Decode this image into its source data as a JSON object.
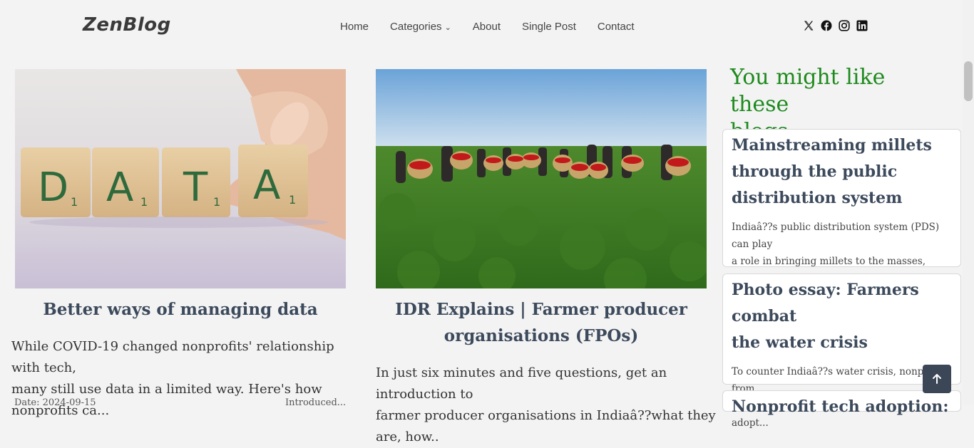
{
  "brand": {
    "logo": "ZenBlog"
  },
  "nav": {
    "items": [
      {
        "label": "Home"
      },
      {
        "label": "Categories"
      },
      {
        "label": "About"
      },
      {
        "label": "Single Post"
      },
      {
        "label": "Contact"
      }
    ]
  },
  "social": [
    "x-icon",
    "facebook-icon",
    "instagram-icon",
    "linkedin-icon"
  ],
  "posts": [
    {
      "title": "Better ways of managing data",
      "excerpt_line1": "While COVID-19 changed nonprofits' relationship with tech,",
      "excerpt_line2": "many still use data in a limited way. Here's how nonprofits ca...",
      "date": "Date: 2024-09-15",
      "author": "Introduced..."
    },
    {
      "title_line1": "IDR Explains | Farmer producer",
      "title_line2": "organisations (FPOs)",
      "excerpt_line1": "In just six minutes and five questions, get an introduction to",
      "excerpt_line2": "farmer producer organisations in Indiaâ??what they are, how.."
    }
  ],
  "sidebar": {
    "heading_line1": "You might like these",
    "heading_line2": "blogs:-",
    "cards": [
      {
        "title_line1": "Mainstreaming millets",
        "title_line2": "through the public",
        "title_line3": "distribution system",
        "excerpt_line1": "Indiaâ??s public distribution system (PDS) can play",
        "excerpt_line2": "a role in bringing millets to the masses, echoing its..."
      },
      {
        "title_line1": "Photo essay: Farmers combat",
        "title_line2": "the water crisis",
        "excerpt_line1": "To counter Indiaâ??s water crisis, nonprofits from",
        "excerpt_line2": "across the country are helping farmers adopt..."
      },
      {
        "title_line1": "Nonprofit tech adoption:"
      }
    ]
  },
  "colors": {
    "accent": "#1e8a1e",
    "title": "#3c4a5c",
    "button": "#3b4656"
  }
}
